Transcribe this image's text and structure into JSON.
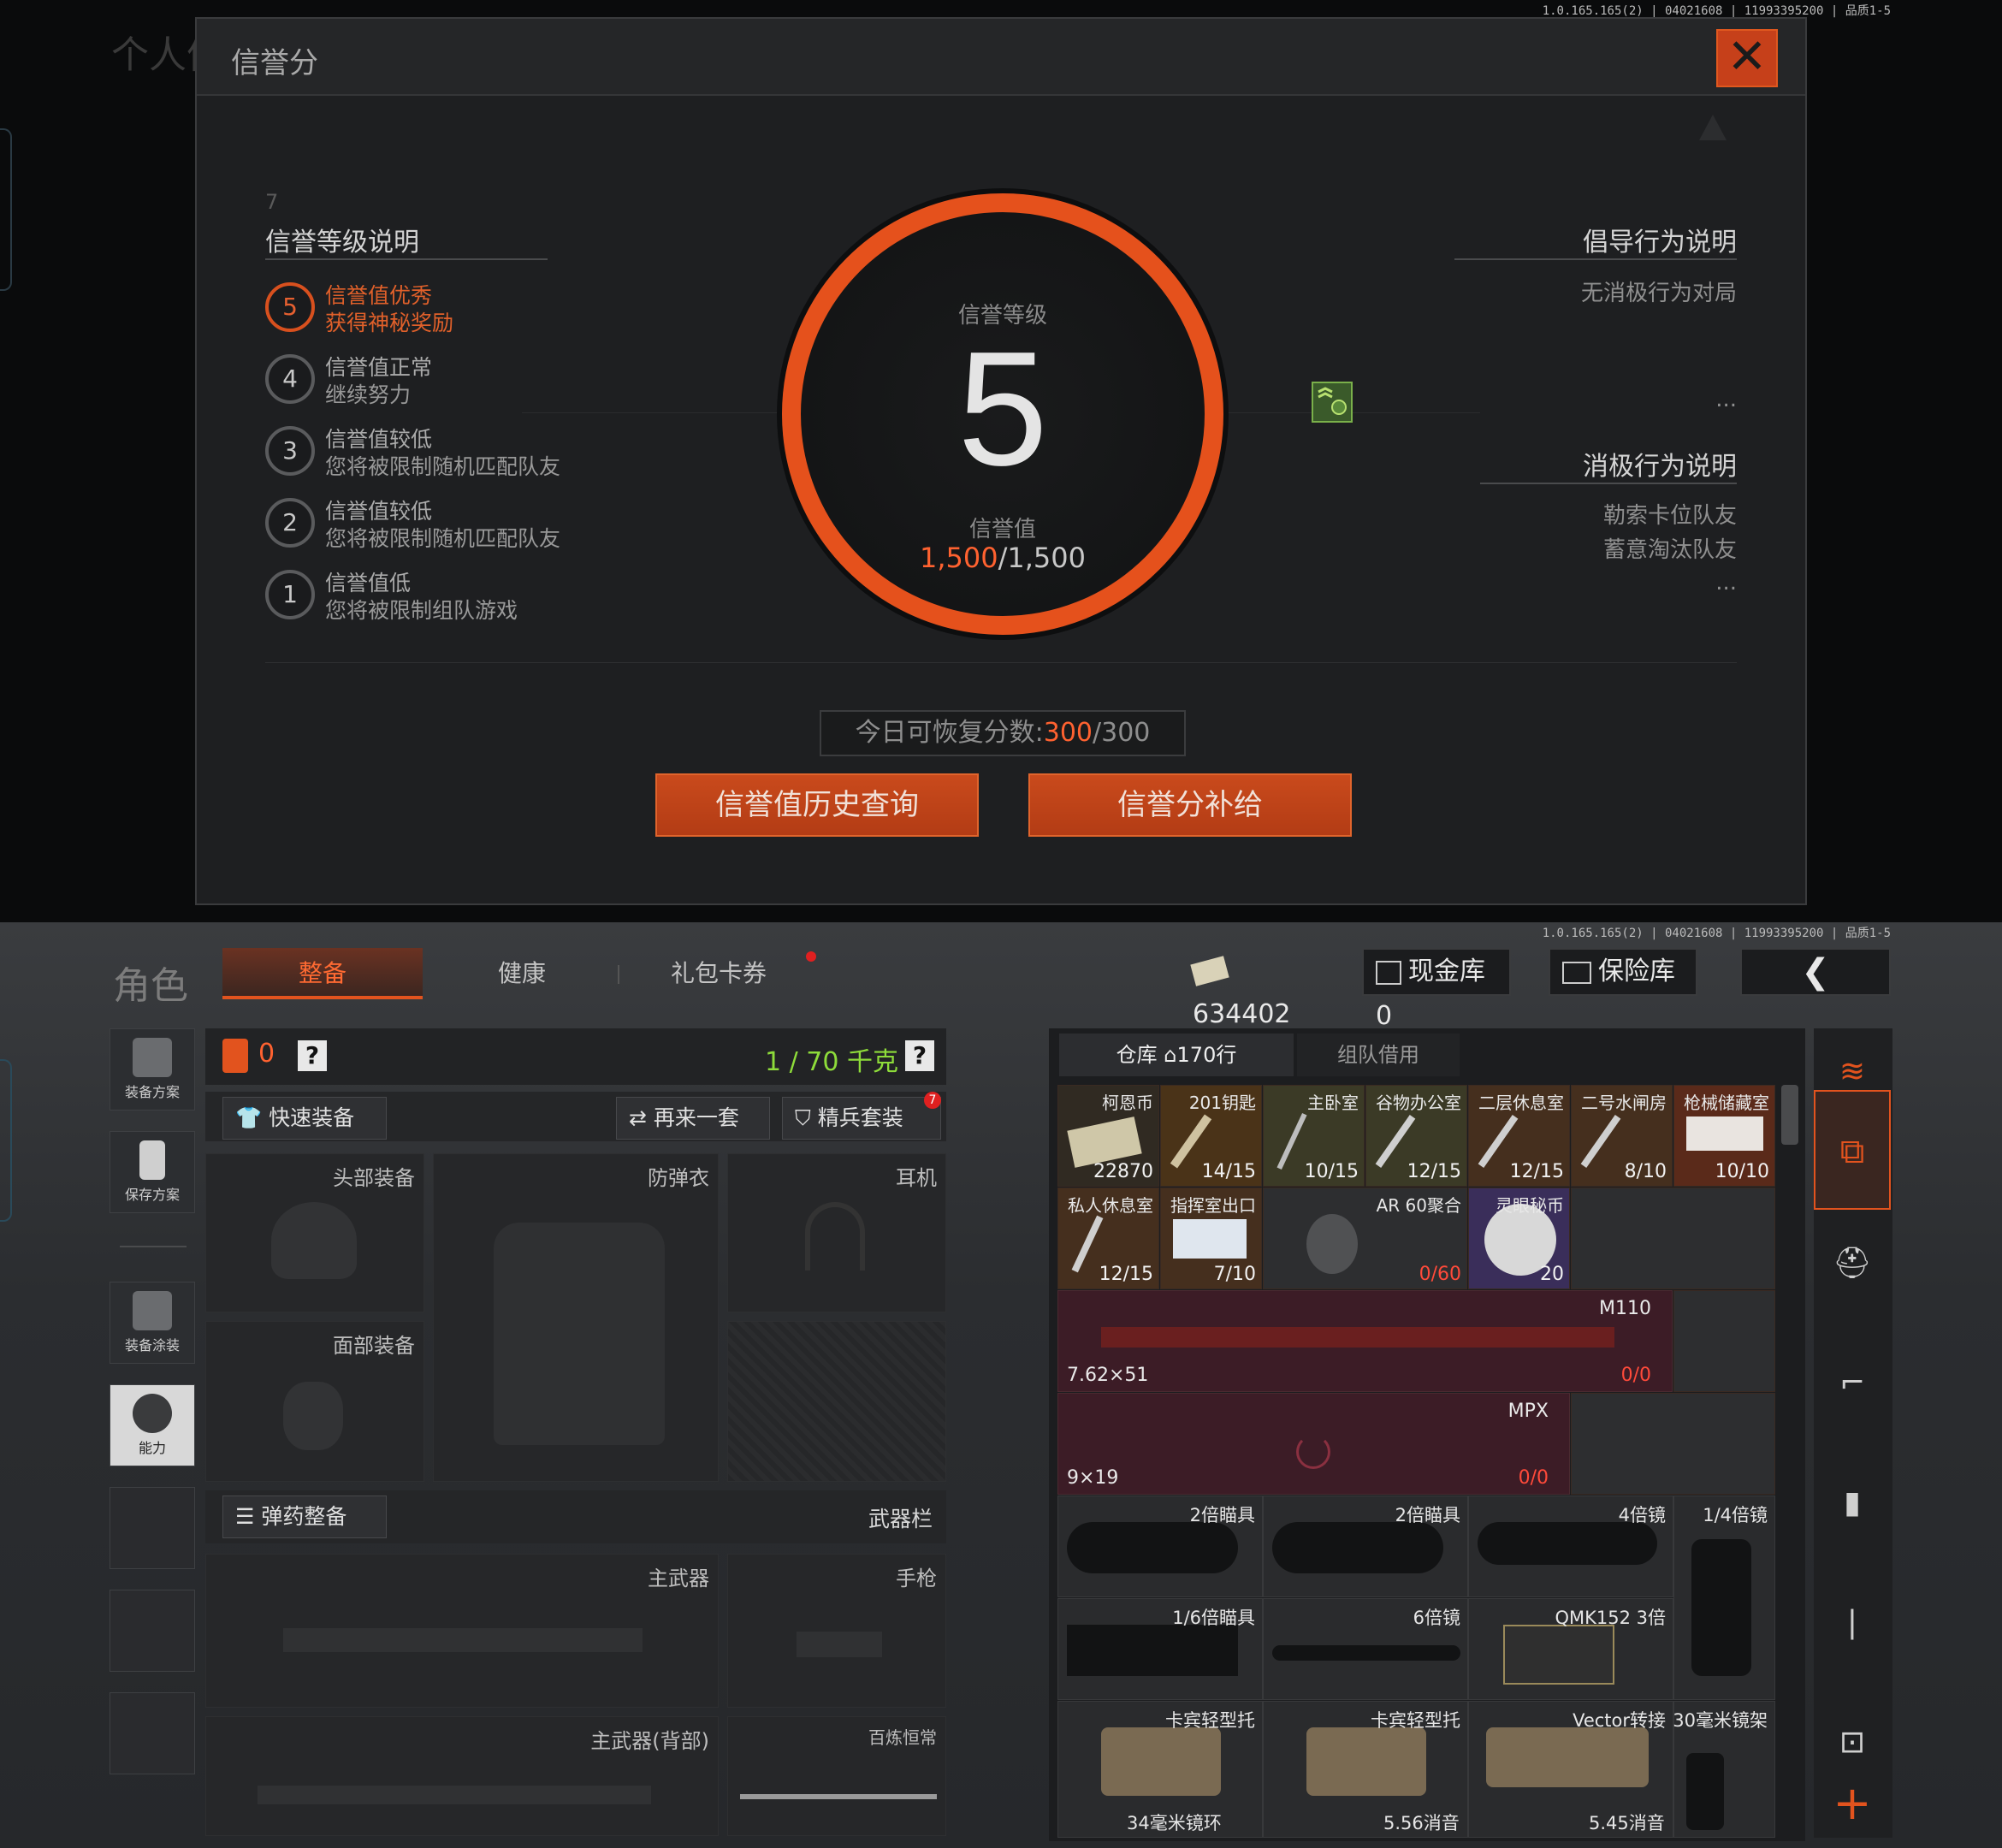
{
  "version": "1.0.165.165(2) | 04021608 | 11993395200 | 品质1-5",
  "modal": {
    "bg_title": "个人信",
    "title": "信誉分",
    "close": "✕",
    "left_header": "信誉等级说明",
    "levels": [
      {
        "num": "5",
        "line1": "信誉值优秀",
        "line2": "获得神秘奖励"
      },
      {
        "num": "4",
        "line1": "信誉值正常",
        "line2": "继续努力"
      },
      {
        "num": "3",
        "line1": "信誉值较低",
        "line2": "您将被限制随机匹配队友"
      },
      {
        "num": "2",
        "line1": "信誉值较低",
        "line2": "您将被限制随机匹配队友"
      },
      {
        "num": "1",
        "line1": "信誉值低",
        "line2": "您将被限制组队游戏"
      }
    ],
    "ring_label": "信誉等级",
    "ring_level": "5",
    "ring_value_label": "信誉值",
    "ring_value_current": "1,500",
    "ring_value_max": "/1,500",
    "positive_header": "倡导行为说明",
    "positive_items": [
      "无消极行为对局",
      "..."
    ],
    "negative_header": "消极行为说明",
    "negative_items": [
      "勒索卡位队友",
      "蓄意淘汰队友",
      "..."
    ],
    "recover_label": "今日可恢复分数:",
    "recover_current": "300",
    "recover_max": "/300",
    "btn_history": "信誉值历史查询",
    "btn_supply": "信誉分补给"
  },
  "bottom": {
    "role_title": "角色",
    "tabs": [
      "整备",
      "健康",
      "礼包卡券"
    ],
    "coins": "634402",
    "cash_vault": "现金库 0",
    "safe": "保险库",
    "back": "❮",
    "side": [
      "装备方案",
      "保存方案",
      "装备涂装",
      "能力"
    ],
    "armor_count": "0",
    "help": "?",
    "weight": "1 / 70 千克",
    "quick_equip": "快速装备",
    "again": "再来一套",
    "elite": "精兵套装",
    "elite_badge": "7",
    "slots": {
      "head": "头部装备",
      "vest": "防弹衣",
      "ear": "耳机",
      "face": "面部装备",
      "ammo": "弹药整备",
      "weapon_bar": "武器栏",
      "primary": "主武器",
      "pistol": "手枪",
      "primary_back": "主武器(背部)",
      "melee": "百炼恒常"
    },
    "warehouse_tab": "仓库",
    "warehouse_rows": "170行",
    "team_borrow": "组队借用",
    "items_row1": [
      {
        "name": "柯恩币",
        "count": "22870"
      },
      {
        "name": "201钥匙",
        "count": "14/15"
      },
      {
        "name": "主卧室",
        "count": "10/15"
      },
      {
        "name": "谷物办公室",
        "count": "12/15"
      },
      {
        "name": "二层休息室",
        "count": "12/15"
      },
      {
        "name": "二号水闸房",
        "count": "8/10"
      },
      {
        "name": "枪械储藏室",
        "count": "10/10"
      }
    ],
    "items_row2": [
      {
        "name": "私人休息室",
        "count": "12/15"
      },
      {
        "name": "指挥室出口",
        "count": "7/10"
      },
      {
        "name": "AR 60聚合",
        "count": "0/60"
      },
      {
        "name": "灵眼秘币",
        "count": "20"
      }
    ],
    "guns": [
      {
        "name": "M110",
        "caliber": "7.62×51",
        "count": "0/0"
      },
      {
        "name": "MPX",
        "caliber": "9×19",
        "count": "0/0"
      }
    ],
    "scopes": [
      "2倍瞄具",
      "2倍瞄具",
      "4倍镜",
      "1/4倍镜",
      "1/6倍瞄具",
      "6倍镜",
      "QMK152 3倍",
      "卡宾轻型托",
      "卡宾轻型托",
      "Vector转接",
      "30毫米镜架"
    ],
    "bottom_labels": [
      "34毫米镜环",
      "5.56消音",
      "5.45消音"
    ],
    "plus": "+"
  },
  "colors": {
    "accent": "#e2531e",
    "accent_text": "#ff6230",
    "green_text": "#8edc3a",
    "key_item_bg": "#4a3318"
  }
}
